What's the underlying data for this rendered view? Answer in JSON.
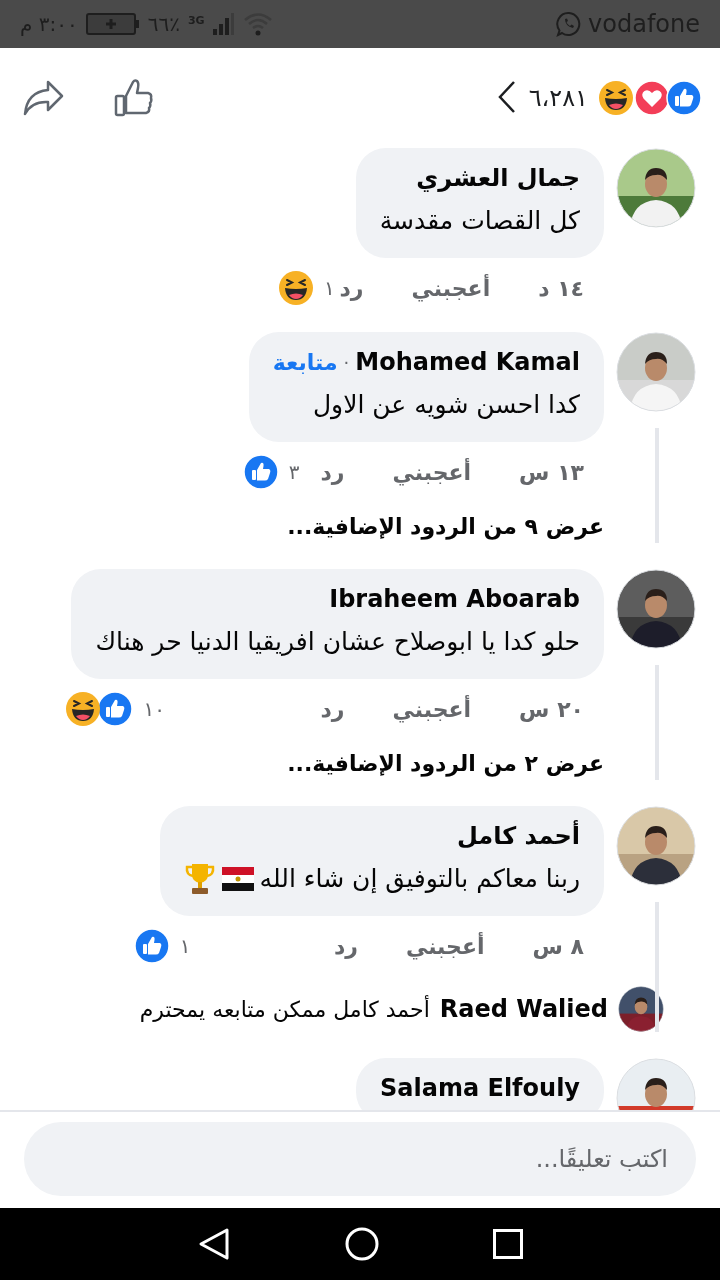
{
  "status_bar": {
    "carrier": "vodafone",
    "network": "3G",
    "battery": "٦٦٪",
    "time": "٣:٠٠ م"
  },
  "header": {
    "reactions": [
      {
        "kind": "like"
      },
      {
        "kind": "love"
      },
      {
        "kind": "haha"
      }
    ],
    "count": "٦،٢٨١"
  },
  "comments": [
    {
      "name": "جمال العشري",
      "text": "كل القصات مقدسة",
      "time": "١٤ د",
      "like": "أعجبني",
      "reply": "رد",
      "reaction_count": "١",
      "reactions": [
        {
          "kind": "haha"
        }
      ],
      "thread": false
    },
    {
      "name": "Mohamed Kamal",
      "separator": "·",
      "follow": "متابعة",
      "text": "كدا احسن شويه عن الاول",
      "time": "١٣ س",
      "like": "أعجبني",
      "reply": "رد",
      "reaction_count": "٣",
      "reactions": [
        {
          "kind": "like"
        }
      ],
      "more_replies": "عرض ٩ من الردود الإضافية...",
      "thread": true
    },
    {
      "name": "Ibraheem Aboarab",
      "text": "حلو كدا يا ابوصلاح عشان افريقيا الدنيا حر هناك",
      "time": "٢٠ س",
      "like": "أعجبني",
      "reply": "رد",
      "reaction_count": "١٠",
      "reactions": [
        {
          "kind": "like"
        },
        {
          "kind": "haha"
        }
      ],
      "more_replies": "عرض ٢ من الردود الإضافية...",
      "thread": true
    },
    {
      "name": "أحمد كامل",
      "text": "ربنا معاكم بالتوفيق إن شاء الله",
      "emoji": [
        {
          "kind": "flag"
        },
        {
          "kind": "trophy"
        }
      ],
      "time": "٨ س",
      "like": "أعجبني",
      "reply": "رد",
      "reaction_count": "١",
      "reactions": [
        {
          "kind": "like"
        }
      ],
      "reply_preview": {
        "name": "Raed Walied",
        "text": "أحمد كامل ممكن متابعه يمحترم"
      },
      "thread": true
    },
    {
      "name": "Salama Elfouly",
      "thread": false
    }
  ],
  "composer": {
    "placeholder": "اكتب تعليقًا..."
  }
}
